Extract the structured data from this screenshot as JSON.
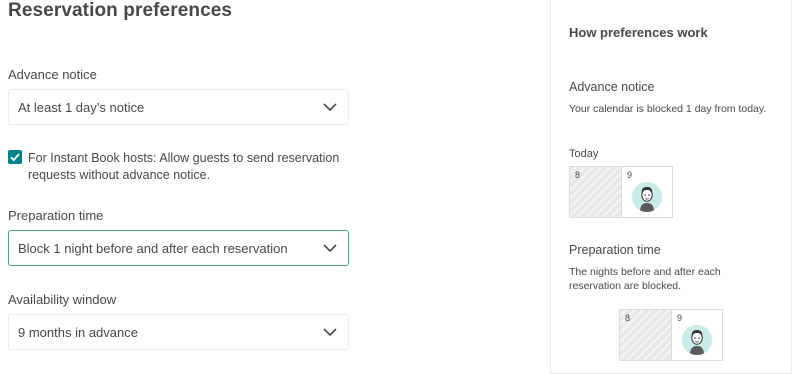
{
  "page": {
    "title": "Reservation preferences"
  },
  "advance_notice": {
    "label": "Advance notice",
    "value": "At least 1 day’s notice"
  },
  "instant_book": {
    "checked": true,
    "label": "For Instant Book hosts: Allow guests to send reservation requests without advance notice."
  },
  "preparation_time": {
    "label": "Preparation time",
    "value": "Block 1 night before and after each reservation"
  },
  "availability_window": {
    "label": "Availability window",
    "value": "9 months in advance"
  },
  "panel": {
    "title": "How preferences work",
    "advance": {
      "heading": "Advance notice",
      "description": "Your calendar is blocked 1 day from today.",
      "today_label": "Today",
      "days": [
        "8",
        "9"
      ]
    },
    "preparation": {
      "heading": "Preparation time",
      "description": "The nights before and after each reservation are blocked.",
      "days": [
        "8",
        "9"
      ]
    }
  },
  "colors": {
    "accent": "#008489",
    "active_border": "#4f9f8f",
    "avatar_bg": "#c9ece6"
  },
  "icons": [
    "chevron-down-icon",
    "checkmark-icon",
    "guest-avatar-icon"
  ]
}
